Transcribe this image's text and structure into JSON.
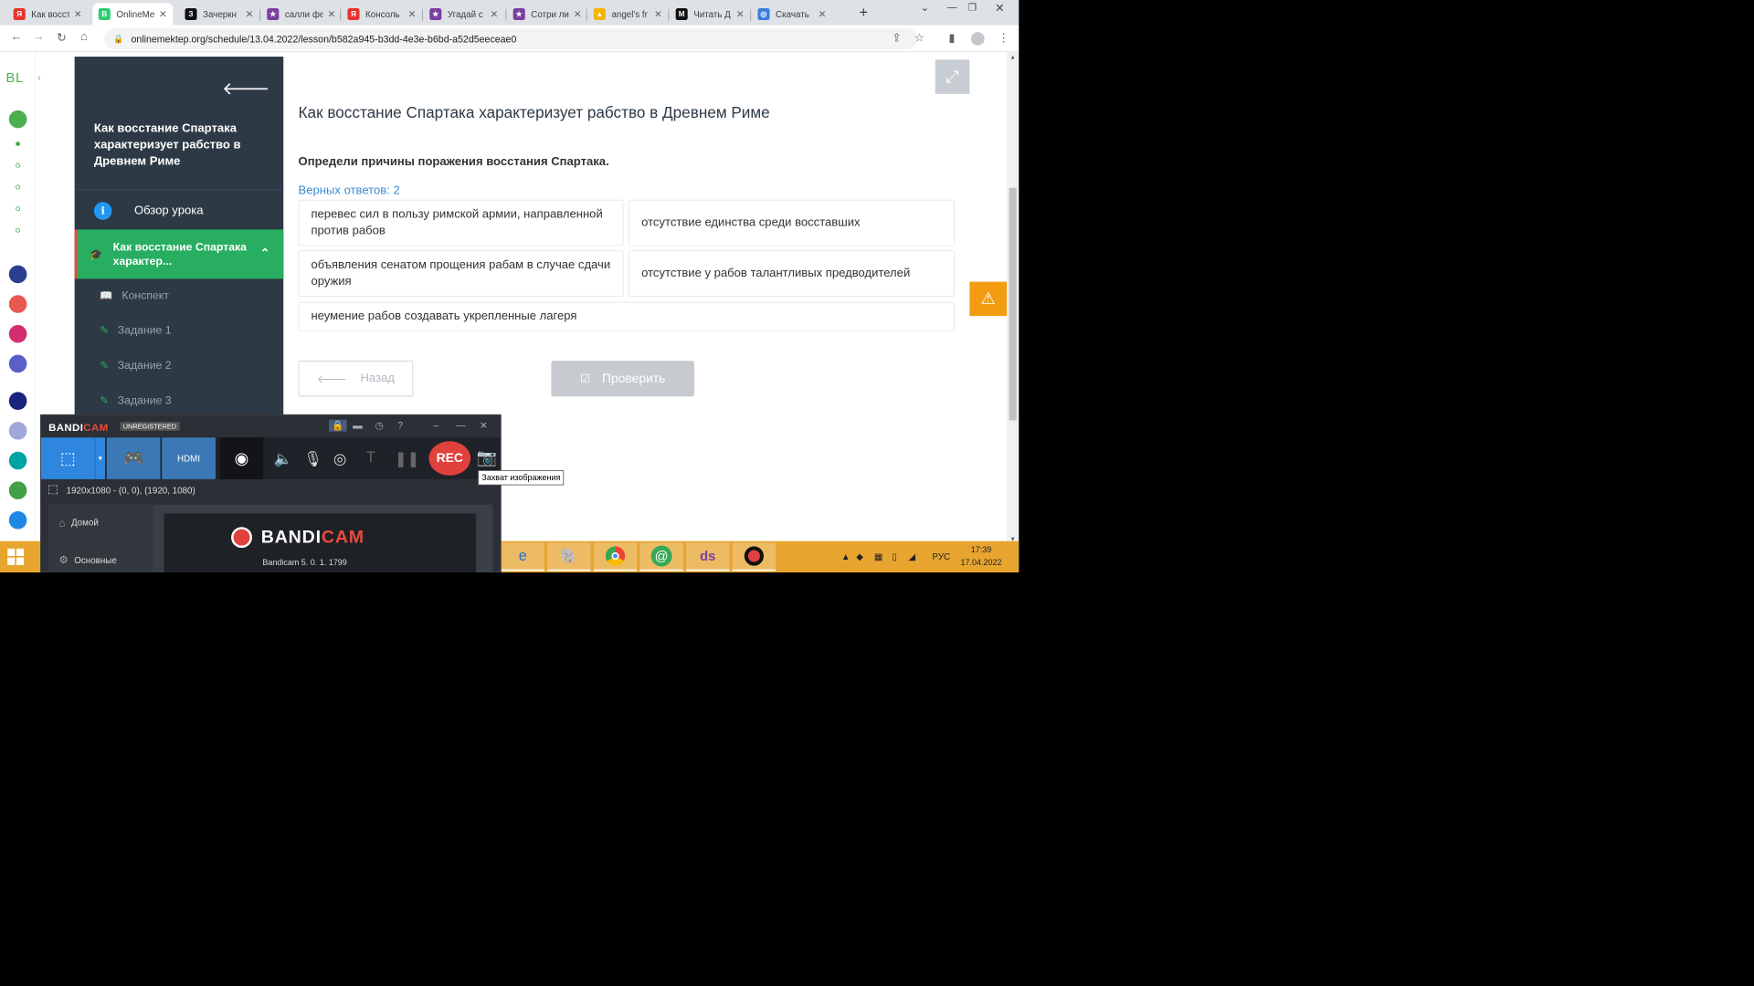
{
  "browser": {
    "tabs": [
      {
        "label": "Как восстание",
        "icon_letter": "Я",
        "icon_color": "#e8332a"
      },
      {
        "label": "OnlineMektep",
        "icon_letter": "B",
        "icon_color": "#2ecc71",
        "active": true
      },
      {
        "label": "Зачеркн",
        "icon_letter": "З",
        "icon_color": "#111111"
      },
      {
        "label": "салли фе",
        "icon_letter": "★",
        "icon_color": "#7b3fa0"
      },
      {
        "label": "Консоль",
        "icon_letter": "Я",
        "icon_color": "#e8332a"
      },
      {
        "label": "Угадай с",
        "icon_letter": "★",
        "icon_color": "#7b3fa0"
      },
      {
        "label": "Сотри ли",
        "icon_letter": "★",
        "icon_color": "#7b3fa0"
      },
      {
        "label": "angel's fr",
        "icon_letter": "▲",
        "icon_color": "#f4b400"
      },
      {
        "label": "Читать Д",
        "icon_letter": "M",
        "icon_color": "#111111"
      },
      {
        "label": "Скачать",
        "icon_letter": "◎",
        "icon_color": "#3b7ddd"
      }
    ],
    "url": "onlinemektep.org/schedule/13.04.2022/lesson/b582a945-b3dd-4e3e-b6bd-a52d5eeceae0"
  },
  "rail": {
    "brand": "BL"
  },
  "sidebar": {
    "lesson_title": "Как восстание Спартака характеризует рабство в Древнем Риме",
    "overview_label": "Обзор урока",
    "current_section": "Как восстание Спартака характер...",
    "items": [
      "Конспект",
      "Задание 1",
      "Задание 2",
      "Задание 3"
    ]
  },
  "main": {
    "title": "Как восстание Спартака характеризует рабство в Древнем Риме",
    "question": "Определи причины поражения восстания Спартака.",
    "correct_count": "Верных ответов: 2",
    "options": [
      "перевес сил в пользу римской армии, направленной против рабов",
      "отсутствие единства среди восставших",
      "объявления сенатом прощения рабам в случае сдачи оружия",
      "отсутствие у рабов талантливых предводителей",
      "неумение рабов создавать укрепленные лагеря"
    ],
    "back_label": "Назад",
    "check_label": "Проверить"
  },
  "bandicam": {
    "brand_a": "BANDI",
    "brand_b": "CAM",
    "unregistered": "UNREGISTERED",
    "rec_label": "REC",
    "resolution": "1920x1080 - (0, 0), (1920, 1080)",
    "menu_home": "Домой",
    "menu_basic": "Основные",
    "panel_brand_a": "BANDI",
    "panel_brand_b": "CAM",
    "version": "Bandicam 5. 0. 1. 1799",
    "tooltip": "Захват изображения"
  },
  "taskbar": {
    "language": "РУС",
    "time": "17:39",
    "date": "17.04.2022"
  },
  "colors": {
    "sidebar_bg": "#2d3a46",
    "active_green": "#27ae60",
    "link_blue": "#3b8bd6",
    "warning": "#f39c12",
    "taskbar": "#e7a530",
    "rec_red": "#e0413c"
  }
}
